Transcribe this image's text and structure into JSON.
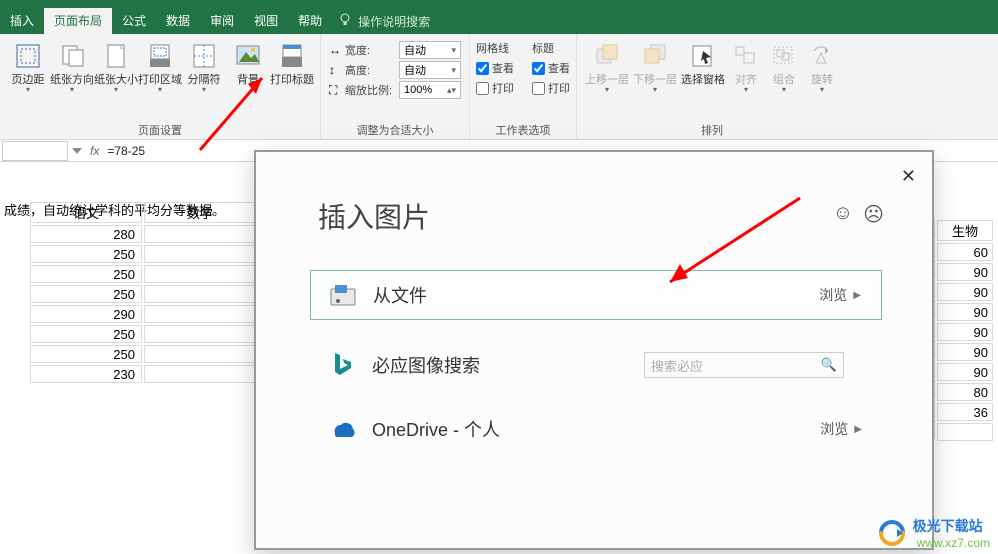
{
  "tabs": {
    "insert": "插入",
    "layout": "页面布局",
    "formulas": "公式",
    "data": "数据",
    "review": "审阅",
    "view": "视图",
    "help": "帮助",
    "tellme": "操作说明搜索"
  },
  "ribbon": {
    "pageSetup": {
      "label": "页面设置",
      "margins": "页边距",
      "orientation": "纸张方向",
      "size": "纸张大小",
      "printArea": "打印区域",
      "breaks": "分隔符",
      "background": "背景",
      "printTitles": "打印标题"
    },
    "scale": {
      "label": "调整为合适大小",
      "widthLabel": "宽度:",
      "widthVal": "自动",
      "heightLabel": "高度:",
      "heightVal": "自动",
      "scaleLabel": "缩放比例:",
      "scaleVal": "100%"
    },
    "sheetOptions": {
      "label": "工作表选项",
      "grid": "网格线",
      "headings": "标题",
      "view": "查看",
      "print": "打印"
    },
    "arrange": {
      "label": "排列",
      "bringFwd": "上移一层",
      "sendBack": "下移一层",
      "selection": "选择窗格",
      "align": "对齐",
      "group": "组合",
      "rotate": "旋转"
    }
  },
  "formulaBar": {
    "formula": "=78-25"
  },
  "sheet": {
    "rowLabel": "成绩，自动统计学科的平均分等数据。",
    "hdrA": "语文",
    "hdrB": "数学",
    "colA": [
      "280",
      "250",
      "250",
      "250",
      "290",
      "250",
      "250",
      "230"
    ],
    "rightHdr": "生物",
    "colRight": [
      "60",
      "90",
      "90",
      "90",
      "90",
      "90",
      "90",
      "80",
      "36",
      ""
    ]
  },
  "dialog": {
    "title": "插入图片",
    "fromFile": "从文件",
    "browse": "浏览",
    "bing": "必应图像搜索",
    "searchPH": "搜索必应",
    "onedrive": "OneDrive - 个人"
  },
  "wm": {
    "brand": "极光下载站",
    "url": "www.xz7.com"
  }
}
